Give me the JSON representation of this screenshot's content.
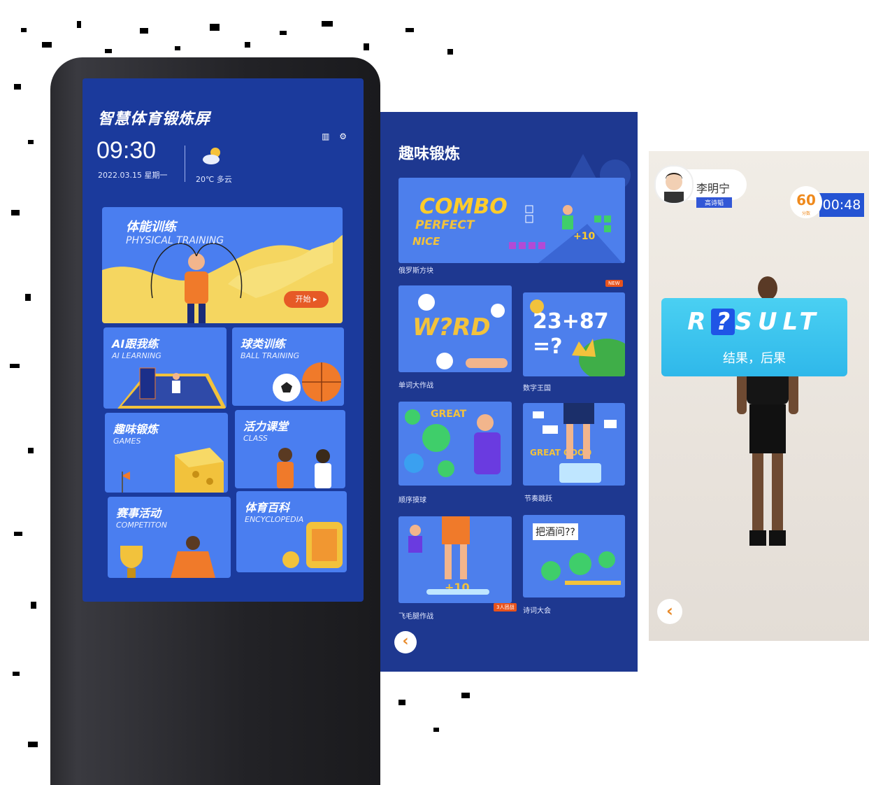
{
  "kiosk": {
    "title": "智慧体育锻炼屏",
    "time": "09:30",
    "date": "2022.03.15 星期一",
    "weather": "20℃ 多云",
    "hero": {
      "title": "体能训练",
      "subtitle": "PHYSICAL TRAINING",
      "start_label": "开始 ▸"
    },
    "cards": [
      {
        "title": "AI跟我练",
        "subtitle": "AI LEARNING"
      },
      {
        "title": "球类训练",
        "subtitle": "BALL TRAINING"
      },
      {
        "title": "趣味锻炼",
        "subtitle": "GAMES"
      },
      {
        "title": "活力课堂",
        "subtitle": "CLASS"
      },
      {
        "title": "赛事活动",
        "subtitle": "COMPETITON"
      },
      {
        "title": "体育百科",
        "subtitle": "ENCYCLOPEDIA"
      }
    ]
  },
  "games": {
    "title": "趣味锻炼",
    "featured": {
      "label": "俄罗斯方块",
      "badge": "NEW",
      "words": [
        "COMBO",
        "PERFECT",
        "NICE"
      ],
      "bonus": "+10"
    },
    "items": [
      {
        "label": "单词大作战",
        "art": "W?RD"
      },
      {
        "label": "数字王国",
        "art": "23+87 =?"
      },
      {
        "label": "顺序摸球",
        "art": "GREAT"
      },
      {
        "label": "节奏跳跃",
        "art": "GREAT GOOD"
      },
      {
        "label": "飞毛腿作战",
        "art": "+10",
        "badge": "3人团战"
      },
      {
        "label": "诗词大会",
        "art": "把酒问??"
      }
    ]
  },
  "result": {
    "user_name": "李明宁",
    "user_tag": "高诗韬",
    "score": "60",
    "score_unit": "分数",
    "timer": "00:48",
    "word_left": "R",
    "word_hidden": "?",
    "word_right": "SULT",
    "meaning": "结果，后果"
  },
  "colors": {
    "kiosk_screen": "#1b3a9c",
    "card": "#4a7ef0",
    "accent_orange": "#e65a26",
    "result_banner": "#3cc4ef"
  }
}
